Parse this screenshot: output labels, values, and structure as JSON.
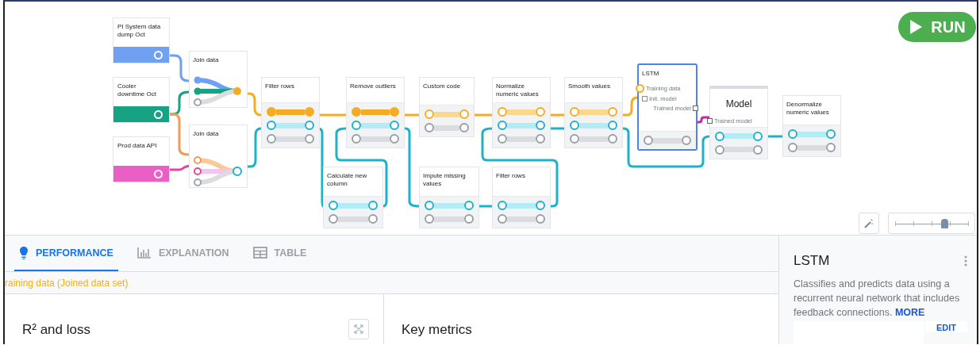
{
  "run_button": {
    "label": "RUN"
  },
  "sources": [
    {
      "title": "PI System data dump Oct",
      "color": "#6fa0f2"
    },
    {
      "title": "Cooler downtime Oct",
      "color": "#16a383"
    },
    {
      "title": "Prod data API",
      "color": "#ea5fc6"
    }
  ],
  "steps": [
    {
      "title": "Join data",
      "kind": "join",
      "selected": false
    },
    {
      "title": "Join data",
      "kind": "join",
      "selected": false
    },
    {
      "title": "Filter rows",
      "kind": "step",
      "selected": false
    },
    {
      "title": "Remove outliers",
      "kind": "step",
      "selected": false
    },
    {
      "title": "Custom code",
      "kind": "step",
      "selected": false
    },
    {
      "title": "Normalize numeric values",
      "kind": "step",
      "selected": false
    },
    {
      "title": "Smooth values",
      "kind": "step",
      "selected": false
    },
    {
      "title": "LSTM",
      "kind": "algorithm",
      "selected": true,
      "ports": [
        "Training data",
        "Init. model",
        "Trained model"
      ]
    },
    {
      "title": "Model",
      "kind": "model",
      "selected": false,
      "ports": [
        "Trained model"
      ]
    },
    {
      "title": "Denormalize numeric values",
      "kind": "step",
      "selected": false
    },
    {
      "title": "Calculate new column",
      "kind": "step",
      "selected": false
    },
    {
      "title": "Impute missing values",
      "kind": "step",
      "selected": false
    },
    {
      "title": "Filter rows",
      "kind": "step",
      "selected": false
    }
  ],
  "zoom_slider": {
    "level": 0.68
  },
  "tabs": [
    {
      "label": "PERFORMANCE",
      "selected": true
    },
    {
      "label": "EXPLANATION",
      "selected": false
    },
    {
      "label": "TABLE",
      "selected": false
    }
  ],
  "dataset_label": "raining data (Joined data set)",
  "cards": [
    {
      "title": "R² and loss"
    },
    {
      "title": "Key metrics"
    }
  ],
  "details": {
    "title": "LSTM",
    "description": "Classifies and predicts data using a recurrent neural network that includes feedback connections.",
    "link": "MORE",
    "button": "EDIT"
  }
}
